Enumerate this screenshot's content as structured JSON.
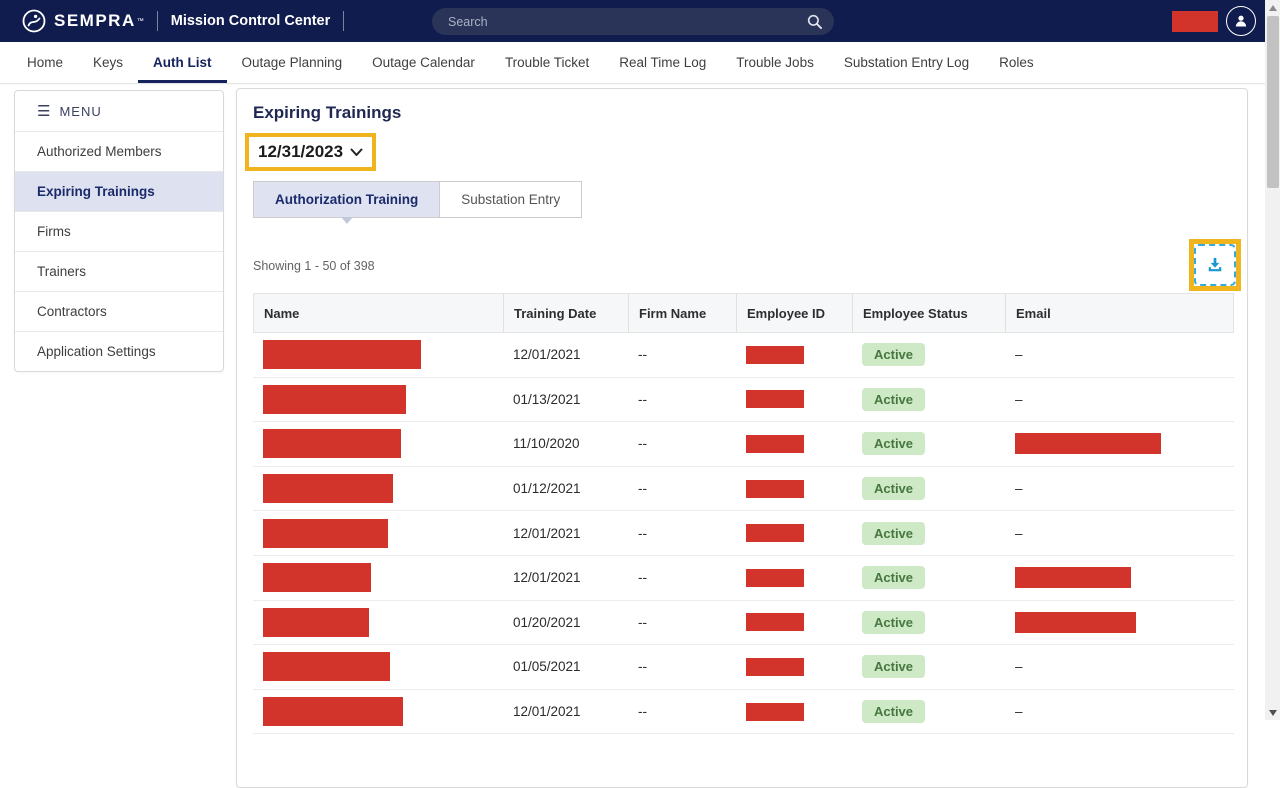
{
  "topbar": {
    "brand": "SEMPRA",
    "brand_mark": "™",
    "app_title": "Mission Control Center",
    "search": {
      "placeholder": "Search",
      "value": ""
    }
  },
  "nav": {
    "items": [
      {
        "label": "Home",
        "active": false
      },
      {
        "label": "Keys",
        "active": false
      },
      {
        "label": "Auth List",
        "active": true
      },
      {
        "label": "Outage Planning",
        "active": false
      },
      {
        "label": "Outage Calendar",
        "active": false
      },
      {
        "label": "Trouble Ticket",
        "active": false
      },
      {
        "label": "Real Time Log",
        "active": false
      },
      {
        "label": "Trouble Jobs",
        "active": false
      },
      {
        "label": "Substation Entry Log",
        "active": false
      },
      {
        "label": "Roles",
        "active": false
      }
    ]
  },
  "sidebar": {
    "menu_label": "MENU",
    "items": [
      {
        "label": "Authorized Members",
        "active": false
      },
      {
        "label": "Expiring Trainings",
        "active": true
      },
      {
        "label": "Firms",
        "active": false
      },
      {
        "label": "Trainers",
        "active": false
      },
      {
        "label": "Contractors",
        "active": false
      },
      {
        "label": "Application Settings",
        "active": false
      }
    ]
  },
  "main": {
    "title": "Expiring Trainings",
    "date_filter": {
      "value": "12/31/2023"
    },
    "tabs": [
      {
        "label": "Authorization Training",
        "active": true
      },
      {
        "label": "Substation Entry",
        "active": false
      }
    ],
    "showing_text": "Showing 1 - 50 of 398",
    "table": {
      "columns": [
        "Name",
        "Training Date",
        "Firm Name",
        "Employee ID",
        "Employee Status",
        "Email"
      ],
      "rows": [
        {
          "name_redacted": true,
          "name_box_width": 158,
          "training_date": "12/01/2021",
          "firm_name": "--",
          "employee_id_redacted": true,
          "employee_status": "Active",
          "email": "–",
          "email_redacted": false,
          "email_box_width": 0
        },
        {
          "name_redacted": true,
          "name_box_width": 143,
          "training_date": "01/13/2021",
          "firm_name": "--",
          "employee_id_redacted": true,
          "employee_status": "Active",
          "email": "–",
          "email_redacted": false,
          "email_box_width": 0
        },
        {
          "name_redacted": true,
          "name_box_width": 138,
          "training_date": "11/10/2020",
          "firm_name": "--",
          "employee_id_redacted": true,
          "employee_status": "Active",
          "email": "",
          "email_redacted": true,
          "email_box_width": 146
        },
        {
          "name_redacted": true,
          "name_box_width": 130,
          "training_date": "01/12/2021",
          "firm_name": "--",
          "employee_id_redacted": true,
          "employee_status": "Active",
          "email": "–",
          "email_redacted": false,
          "email_box_width": 0
        },
        {
          "name_redacted": true,
          "name_box_width": 125,
          "training_date": "12/01/2021",
          "firm_name": "--",
          "employee_id_redacted": true,
          "employee_status": "Active",
          "email": "–",
          "email_redacted": false,
          "email_box_width": 0
        },
        {
          "name_redacted": true,
          "name_box_width": 108,
          "training_date": "12/01/2021",
          "firm_name": "--",
          "employee_id_redacted": true,
          "employee_status": "Active",
          "email": "",
          "email_redacted": true,
          "email_box_width": 116
        },
        {
          "name_redacted": true,
          "name_box_width": 106,
          "training_date": "01/20/2021",
          "firm_name": "--",
          "employee_id_redacted": true,
          "employee_status": "Active",
          "email": "",
          "email_redacted": true,
          "email_box_width": 121
        },
        {
          "name_redacted": true,
          "name_box_width": 127,
          "training_date": "01/05/2021",
          "firm_name": "--",
          "employee_id_redacted": true,
          "employee_status": "Active",
          "email": "–",
          "email_redacted": false,
          "email_box_width": 0
        },
        {
          "name_redacted": true,
          "name_box_width": 140,
          "training_date": "12/01/2021",
          "firm_name": "--",
          "employee_id_redacted": true,
          "employee_status": "Active",
          "email": "–",
          "email_redacted": false,
          "email_box_width": 0
        }
      ]
    }
  },
  "colors": {
    "topbar_navy": "#101c4d",
    "accent_navy": "#1b2a6b",
    "highlight_gold": "#f0b41c",
    "redaction_red": "#d2342c",
    "badge_green_bg": "#cde9c6",
    "badge_green_text": "#47763f",
    "download_blue": "#1b97d4"
  }
}
